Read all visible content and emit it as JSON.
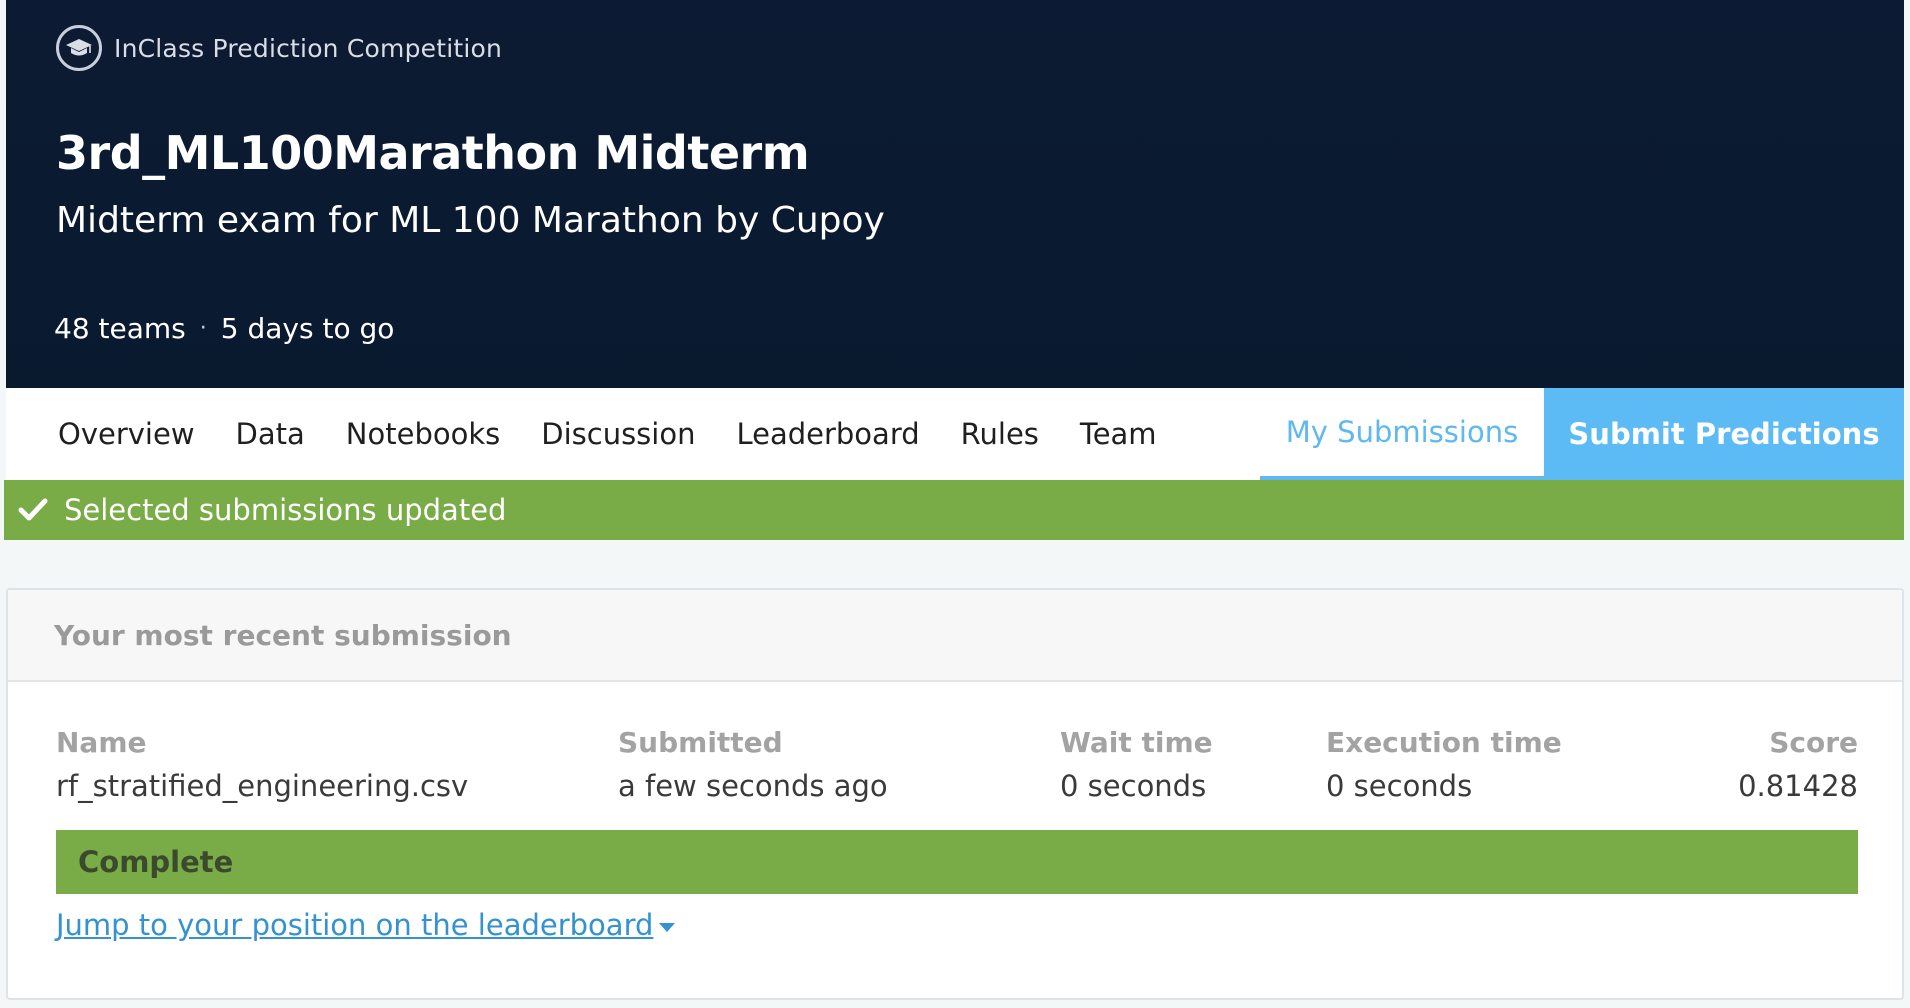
{
  "header": {
    "competition_type": "InClass Prediction Competition",
    "title": "3rd_ML100Marathon Midterm",
    "subtitle": "Midterm exam for ML 100 Marathon by Cupoy",
    "teams": "48 teams",
    "separator": "·",
    "deadline": "5 days to go"
  },
  "nav": {
    "tabs": [
      {
        "label": "Overview"
      },
      {
        "label": "Data"
      },
      {
        "label": "Notebooks"
      },
      {
        "label": "Discussion"
      },
      {
        "label": "Leaderboard"
      },
      {
        "label": "Rules"
      },
      {
        "label": "Team"
      }
    ],
    "my_submissions": "My Submissions",
    "submit_predictions": "Submit Predictions"
  },
  "alert": {
    "text": "Selected submissions updated"
  },
  "recent_submission": {
    "heading": "Your most recent submission",
    "columns": {
      "name": "Name",
      "submitted": "Submitted",
      "wait_time": "Wait time",
      "execution_time": "Execution time",
      "score": "Score"
    },
    "values": {
      "name": "rf_stratified_engineering.csv",
      "submitted": "a few seconds ago",
      "wait_time": "0 seconds",
      "execution_time": "0 seconds",
      "score": "0.81428"
    },
    "status": "Complete",
    "jump_link": "Jump to your position on the leaderboard"
  },
  "colors": {
    "hero_bg": "#0c1b33",
    "accent_blue": "#5cbaf4",
    "success_green": "#79ab47",
    "link_blue": "#3492d1"
  }
}
